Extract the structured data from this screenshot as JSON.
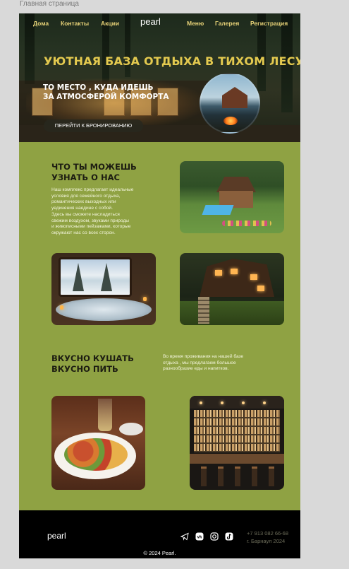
{
  "frame_label": "Главная страница",
  "nav": {
    "logo": "pearl",
    "left_items": [
      "Дома",
      "Контакты",
      "Акции"
    ],
    "right_items": [
      "Меню",
      "Галерея",
      "Регистрация"
    ]
  },
  "hero": {
    "title": "УЮТНАЯ БАЗА ОТДЫХА В ТИХОМ ЛЕСУ",
    "subtitle_line1": "ТО МЕСТО , КУДА ИДЕШЬ",
    "subtitle_line2": "ЗА АТМОСФЕРОЙ КОМФОРТА",
    "cta_label": "ПЕРЕЙТИ К БРОНИРОВАНИЮ"
  },
  "about": {
    "title_line1": "ЧТО ТЫ МОЖЕШЬ",
    "title_line2": "УЗНАТЬ О НАС",
    "text_lines": [
      "Наш комплекс предлагает идеальные",
      "условия для семейного отдыха,",
      "романтических выходных или",
      "уединения наедине с собой.",
      "Здесь вы сможете насладиться",
      "свежим воздухом, звуками природы",
      "и живописными пейзажами, которые",
      "окружают нас со всех сторон."
    ]
  },
  "food": {
    "title_line1": "ВКУСНО КУШАТЬ",
    "title_line2": "ВКУСНО ПИТЬ",
    "text_lines": [
      "Во время проживания на нашей базе",
      "отдыха , мы предлагаем большое",
      "разнообразие еды и напитков."
    ]
  },
  "footer": {
    "logo": "pearl",
    "phone": "+7 913 082 66-68",
    "city": "г. Барнаул 2024",
    "copyright": "© 2024 Pearl.",
    "social_icons": [
      "telegram-icon",
      "vk-icon",
      "instagram-icon",
      "tiktok-icon"
    ]
  },
  "colors": {
    "page_green": "#8fa243",
    "accent_gold": "#e3c94f",
    "footer_black": "#000000"
  }
}
